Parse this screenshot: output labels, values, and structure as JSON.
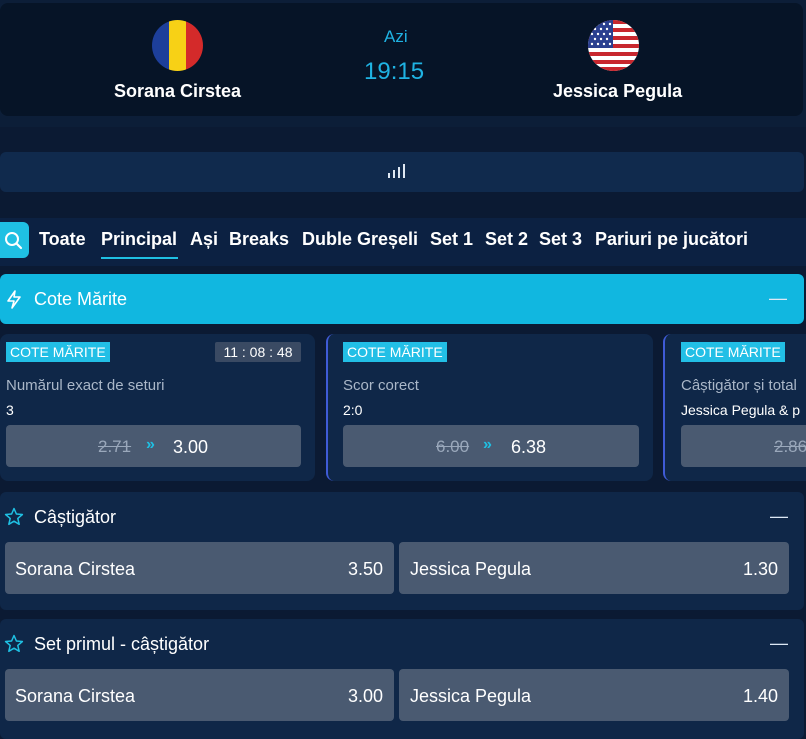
{
  "match": {
    "home": "Sorana Cirstea",
    "away": "Jessica Pegula",
    "day": "Azi",
    "time": "19:15"
  },
  "tabs": [
    "Toate",
    "Principal",
    "Ași",
    "Breaks",
    "Duble Greșeli",
    "Set 1",
    "Set 2",
    "Set 3",
    "Pariuri pe jucători"
  ],
  "active_tab": "Principal",
  "boost": {
    "title": "Cote Mărite",
    "collapse": "—",
    "cards": [
      {
        "badge": "COTE MĂRITE",
        "timer": "11 : 08 : 48",
        "market": "Numărul exact de seturi",
        "selection": "3",
        "old_odds": "2.71",
        "arrows": "»",
        "new_odds": "3.00"
      },
      {
        "badge": "COTE MĂRITE",
        "market": "Scor corect",
        "selection": "2:0",
        "old_odds": "6.00",
        "arrows": "»",
        "new_odds": "6.38"
      },
      {
        "badge": "COTE MĂRITE",
        "market": "Câștigător și total",
        "selection": "Jessica Pegula & p",
        "old_odds": "2.86"
      }
    ]
  },
  "markets": [
    {
      "title": "Câștigător",
      "collapse": "—",
      "selections": [
        {
          "name": "Sorana Cirstea",
          "odds": "3.50"
        },
        {
          "name": "Jessica Pegula",
          "odds": "1.30"
        }
      ]
    },
    {
      "title": "Set primul - câștigător",
      "collapse": "—",
      "selections": [
        {
          "name": "Sorana Cirstea",
          "odds": "3.00"
        },
        {
          "name": "Jessica Pegula",
          "odds": "1.40"
        }
      ]
    }
  ],
  "colors": {
    "accent": "#1fc0e3",
    "background": "#0b1a33",
    "card": "#0f2748",
    "button": "#4a5a71"
  },
  "icons": {
    "search": "search-icon",
    "stats": "stats-bars-icon",
    "boost": "lightning-icon",
    "favorite": "star-icon"
  }
}
